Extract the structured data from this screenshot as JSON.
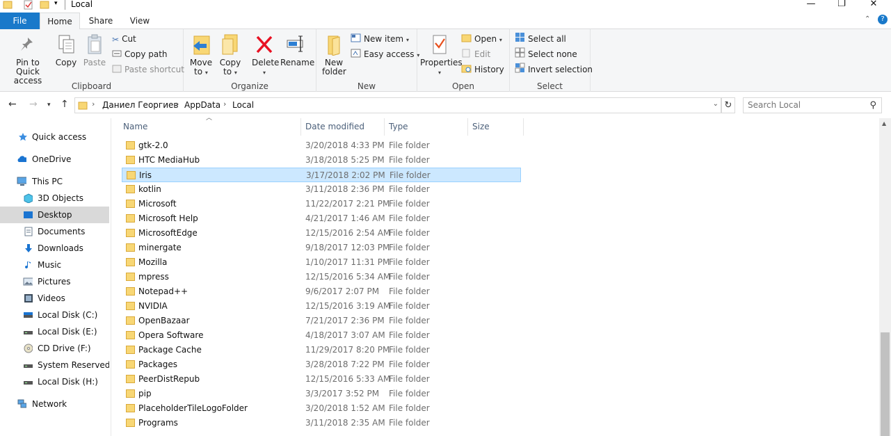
{
  "window": {
    "title": "Local",
    "controls": {
      "minimize": "—",
      "maximize": "❐",
      "close": "✕"
    }
  },
  "ribbon_tabs": {
    "file": "File",
    "home": "Home",
    "share": "Share",
    "view": "View"
  },
  "ribbon": {
    "clipboard": {
      "label": "Clipboard",
      "pin_line1": "Pin to Quick",
      "pin_line2": "access",
      "copy": "Copy",
      "paste": "Paste",
      "cut": "Cut",
      "copy_path": "Copy path",
      "paste_shortcut": "Paste shortcut"
    },
    "organize": {
      "label": "Organize",
      "move_line1": "Move",
      "move_line2": "to",
      "copy_line1": "Copy",
      "copy_line2": "to",
      "delete": "Delete",
      "rename": "Rename"
    },
    "new": {
      "label": "New",
      "new_folder_line1": "New",
      "new_folder_line2": "folder",
      "new_item": "New item",
      "easy_access": "Easy access"
    },
    "open": {
      "label": "Open",
      "properties": "Properties",
      "open": "Open",
      "edit": "Edit",
      "history": "History"
    },
    "select": {
      "label": "Select",
      "select_all": "Select all",
      "select_none": "Select none",
      "invert": "Invert selection"
    }
  },
  "address": {
    "crumbs": [
      "Даниел Георгиев",
      "AppData",
      "Local"
    ]
  },
  "search": {
    "placeholder": "Search Local"
  },
  "nav_pane": [
    {
      "label": "Quick access",
      "icon": "star-icon"
    },
    {
      "label": "OneDrive",
      "icon": "cloud-icon"
    },
    {
      "label": "This PC",
      "icon": "computer-icon"
    },
    {
      "label": "3D Objects",
      "icon": "cube-icon"
    },
    {
      "label": "Desktop",
      "icon": "desktop-icon"
    },
    {
      "label": "Documents",
      "icon": "document-icon"
    },
    {
      "label": "Downloads",
      "icon": "download-icon"
    },
    {
      "label": "Music",
      "icon": "music-icon"
    },
    {
      "label": "Pictures",
      "icon": "picture-icon"
    },
    {
      "label": "Videos",
      "icon": "video-icon"
    },
    {
      "label": "Local Disk (C:)",
      "icon": "drive-icon"
    },
    {
      "label": "Local Disk (E:)",
      "icon": "drive-icon"
    },
    {
      "label": "CD Drive (F:)",
      "icon": "cd-icon"
    },
    {
      "label": "System Reserved (G",
      "icon": "drive-icon"
    },
    {
      "label": "Local Disk (H:)",
      "icon": "drive-icon"
    },
    {
      "label": "Network",
      "icon": "network-icon"
    }
  ],
  "columns": {
    "name": "Name",
    "date": "Date modified",
    "type": "Type",
    "size": "Size"
  },
  "files": [
    {
      "name": "gtk-2.0",
      "date": "3/20/2018 4:33 PM",
      "type": "File folder"
    },
    {
      "name": "HTC MediaHub",
      "date": "3/18/2018 5:25 PM",
      "type": "File folder"
    },
    {
      "name": "Iris",
      "date": "3/17/2018 2:02 PM",
      "type": "File folder"
    },
    {
      "name": "kotlin",
      "date": "3/11/2018 2:36 PM",
      "type": "File folder"
    },
    {
      "name": "Microsoft",
      "date": "11/22/2017 2:21 PM",
      "type": "File folder"
    },
    {
      "name": "Microsoft Help",
      "date": "4/21/2017 1:46 AM",
      "type": "File folder"
    },
    {
      "name": "MicrosoftEdge",
      "date": "12/15/2016 2:54 AM",
      "type": "File folder"
    },
    {
      "name": "minergate",
      "date": "9/18/2017 12:03 PM",
      "type": "File folder"
    },
    {
      "name": "Mozilla",
      "date": "1/10/2017 11:31 PM",
      "type": "File folder"
    },
    {
      "name": "mpress",
      "date": "12/15/2016 5:34 AM",
      "type": "File folder"
    },
    {
      "name": "Notepad++",
      "date": "9/6/2017 2:07 PM",
      "type": "File folder"
    },
    {
      "name": "NVIDIA",
      "date": "12/15/2016 3:19 AM",
      "type": "File folder"
    },
    {
      "name": "OpenBazaar",
      "date": "7/21/2017 2:36 PM",
      "type": "File folder"
    },
    {
      "name": "Opera Software",
      "date": "4/18/2017 3:07 AM",
      "type": "File folder"
    },
    {
      "name": "Package Cache",
      "date": "11/29/2017 8:20 PM",
      "type": "File folder"
    },
    {
      "name": "Packages",
      "date": "3/28/2018 7:22 PM",
      "type": "File folder"
    },
    {
      "name": "PeerDistRepub",
      "date": "12/15/2016 5:33 AM",
      "type": "File folder"
    },
    {
      "name": "pip",
      "date": "3/3/2017 3:52 PM",
      "type": "File folder"
    },
    {
      "name": "PlaceholderTileLogoFolder",
      "date": "3/20/2018 1:52 AM",
      "type": "File folder"
    },
    {
      "name": "Programs",
      "date": "3/11/2018 2:35 AM",
      "type": "File folder"
    }
  ],
  "selected_file": "Iris",
  "selected_nav": "Desktop",
  "colors": {
    "accent": "#1979ca",
    "selection": "#cce8ff",
    "folder": "#f8d775"
  }
}
